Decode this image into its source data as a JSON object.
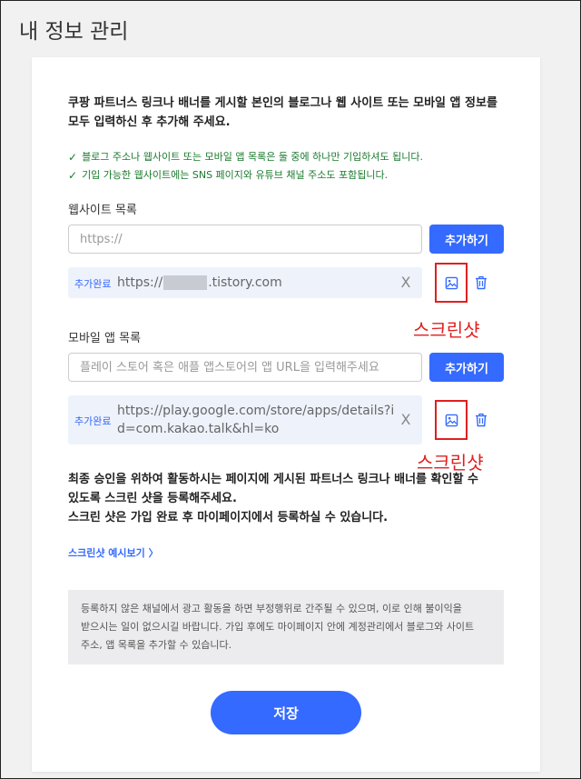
{
  "page": {
    "title": "내 정보 관리"
  },
  "intro": {
    "line1": "쿠팡 파트너스 링크나 배너를 게시할 본인의 블로그나 웹 사이트 또는 모바일 앱 정보를",
    "line2": "모두 입력하신 후 추가해 주세요."
  },
  "notes": [
    {
      "check": "✓",
      "text": "블로그 주소나 웹사이트 또는 모바일 앱 목록은 둘 중에 하나만 기입하셔도 됩니다."
    },
    {
      "check": "✓",
      "text": "기입 가능한 웹사이트에는 SNS 페이지와 유튜브 채널 주소도 포함됩니다."
    }
  ],
  "website": {
    "label": "웹사이트 목록",
    "placeholder": "https://",
    "add_label": "추가하기",
    "entry": {
      "badge": "추가완료",
      "url_prefix": "https://",
      "url_suffix": ".tistory.com",
      "remove": "X"
    },
    "screenshot_annotation": "스크린샷"
  },
  "mobile": {
    "label": "모바일 앱 목록",
    "placeholder": "플레이 스토어 혹은 애플 앱스토어의 앱 URL을 입력해주세요",
    "add_label": "추가하기",
    "entry": {
      "badge": "추가완료",
      "url": "https://play.google.com/store/apps/details?id=com.kakao.talk&hl=ko",
      "remove": "X"
    },
    "screenshot_annotation": "스크린샷"
  },
  "final": {
    "line1": "최종 승인을 위하여 활동하시는 페이지에 게시된 파트너스 링크나 배너를 확인할 수",
    "line2": "있도록 스크린 샷을 등록해주세요.",
    "line3": "스크린 샷은 가입 완료 후 마이페이지에서 등록하실 수 있습니다."
  },
  "example_link": "스크린샷 예시보기 〉",
  "info": {
    "line1": "등록하지 않은 채널에서 광고 활동을 하면 부정행위로 간주될 수 있으며, 이로 인해 불이익을",
    "line2": "받으시는 일이 없으시길 바랍니다. 가입 후에도 마이페이지 안에 계정관리에서 블로그와 사이트",
    "line3": "주소, 앱 목록을 추가할 수 있습니다."
  },
  "save_label": "저장",
  "colors": {
    "accent": "#346aff",
    "annotation": "#e02020",
    "note": "#1a7a2e"
  },
  "icons": {
    "image": "image-icon",
    "trash": "trash-icon",
    "check": "check-icon",
    "close": "close-icon"
  }
}
